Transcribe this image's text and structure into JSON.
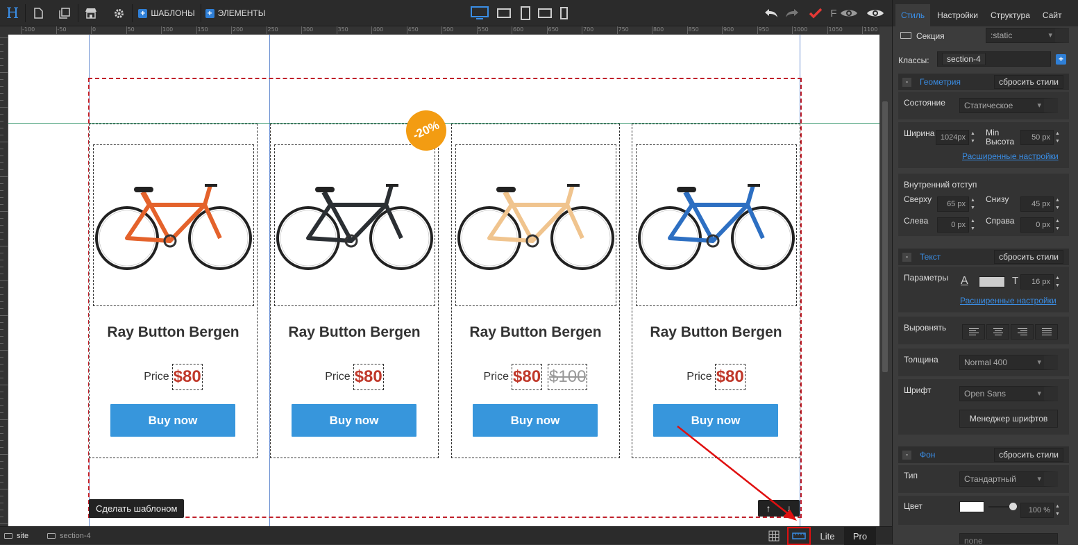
{
  "toolbar": {
    "logo": "H",
    "templates_label": "ШАБЛОНЫ",
    "elements_label": "ЭЛЕМЕНТЫ",
    "f_label": "F"
  },
  "ruler": {
    "ticks": [
      "-100",
      "-50",
      "0",
      "50",
      "100",
      "150",
      "200",
      "250",
      "300",
      "350",
      "400",
      "450",
      "500",
      "550",
      "600",
      "650",
      "700",
      "750",
      "800",
      "850",
      "900",
      "950",
      "1000",
      "1050",
      "1100"
    ]
  },
  "canvas": {
    "badge": "-20%",
    "products": [
      {
        "title": "Ray Button Bergen",
        "price_label": "Price",
        "price": "$80",
        "old_price": "",
        "button": "Buy now",
        "frame": "#e4622b"
      },
      {
        "title": "Ray Button Bergen",
        "price_label": "Price",
        "price": "$80",
        "old_price": "",
        "button": "Buy now",
        "frame": "#2b2f33"
      },
      {
        "title": "Ray Button Bergen",
        "price_label": "Price",
        "price": "$80",
        "old_price": "$100",
        "button": "Buy now",
        "frame": "#f0c48e"
      },
      {
        "title": "Ray Button Bergen",
        "price_label": "Price",
        "price": "$80",
        "old_price": "",
        "button": "Buy now",
        "frame": "#2d6fc2"
      }
    ],
    "make_template": "Сделать шаблоном"
  },
  "statusbar": {
    "crumb1": "site",
    "crumb2": "section-4",
    "lite": "Lite",
    "pro": "Pro"
  },
  "panel": {
    "tabs": [
      "Стиль",
      "Настройки",
      "Структура",
      "Сайт"
    ],
    "element": "Секция",
    "position": ":static",
    "classes_label": "Классы:",
    "class_value": "section-4",
    "geometry": {
      "title": "Геометрия",
      "reset": "сбросить стили",
      "state_label": "Состояние",
      "state_value": "Статическое",
      "width_label": "Ширина",
      "width_value": "1024px",
      "minh_label1": "Min",
      "minh_label2": "Высота",
      "minh_value": "50",
      "minh_unit": "px",
      "advanced": "Расширенные настройки"
    },
    "padding": {
      "title": "Внутренний отступ",
      "top_label": "Сверху",
      "top_value": "65",
      "bottom_label": "Снизу",
      "bottom_value": "45",
      "left_label": "Слева",
      "left_value": "0",
      "right_label": "Справа",
      "right_value": "0",
      "unit": "px"
    },
    "text": {
      "title": "Текст",
      "reset": "сбросить стили",
      "params_label": "Параметры",
      "size_value": "16",
      "size_unit": "px",
      "advanced": "Расширенные настройки",
      "align_label": "Выровнять",
      "weight_label": "Толщина",
      "weight_value": "Normal 400",
      "font_label": "Шрифт",
      "font_value": "Open Sans",
      "font_manager": "Менеджер шрифтов"
    },
    "background": {
      "title": "Фон",
      "reset": "сбросить стили",
      "type_label": "Тип",
      "type_value": "Стандартный",
      "color_label": "Цвет",
      "opacity": "100 %",
      "bottom_value": "none"
    }
  },
  "colors": {
    "accent": "#3a8ee6",
    "buy_button": "#3796dc",
    "price": "#c0392b",
    "badge": "#f39c12",
    "section_outline": "#c0202a",
    "annotation_red": "#e01010"
  }
}
